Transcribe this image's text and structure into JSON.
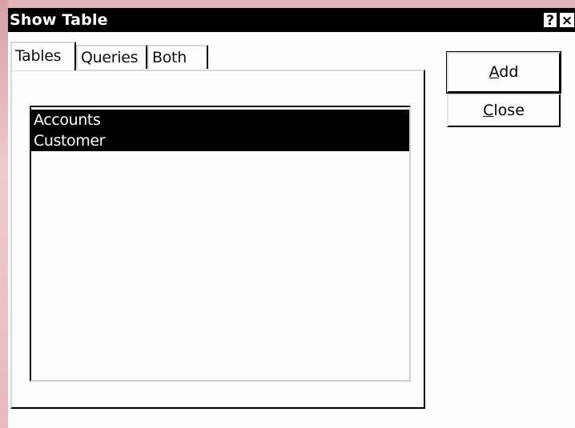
{
  "window": {
    "title": "Show Table",
    "help_label": "?",
    "close_label": "×"
  },
  "tabs": [
    {
      "label": "Tables",
      "selected": true
    },
    {
      "label": "Queries",
      "selected": false
    },
    {
      "label": "Both",
      "selected": false
    }
  ],
  "list": {
    "items": [
      {
        "label": "Accounts",
        "selected": true
      },
      {
        "label": "Customer",
        "selected": true
      }
    ]
  },
  "buttons": {
    "add": {
      "mnemonic": "A",
      "rest": "dd"
    },
    "close": {
      "mnemonic": "C",
      "rest": "lose"
    }
  }
}
